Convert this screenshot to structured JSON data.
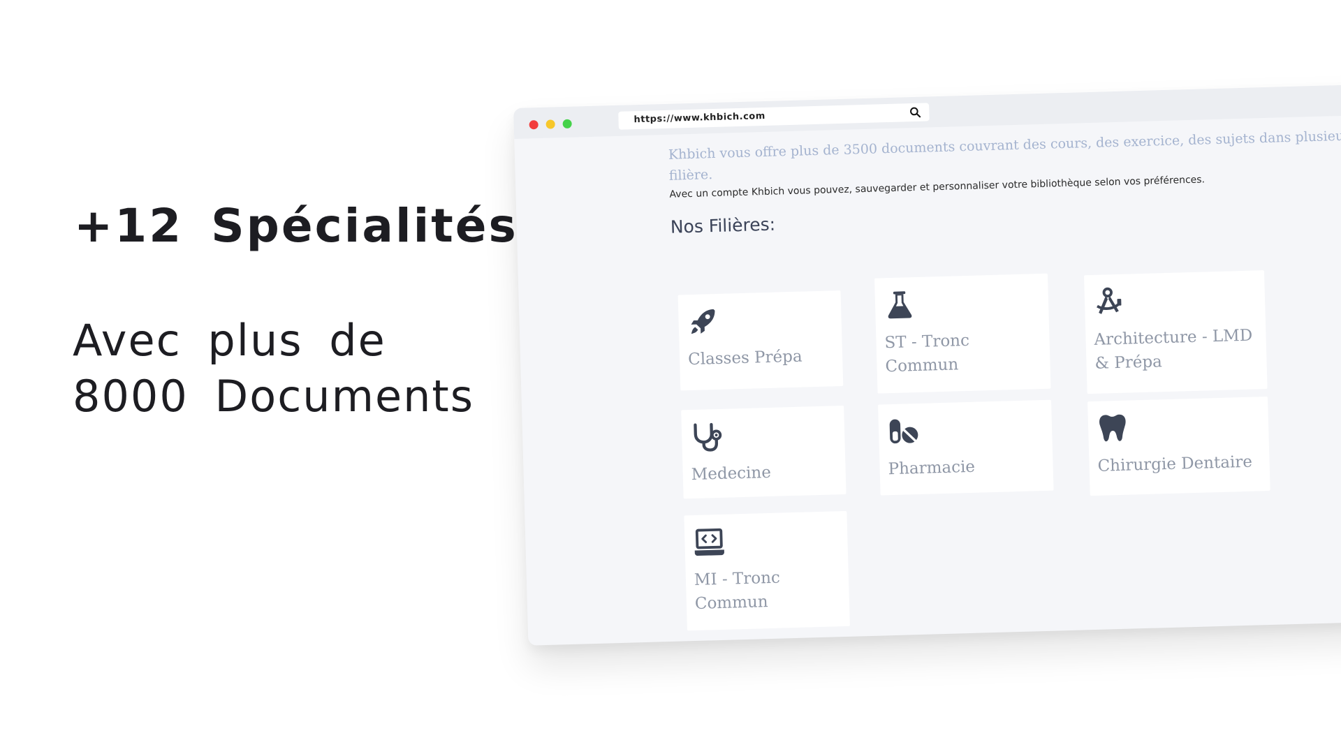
{
  "promo": {
    "headline": "+12 Spécialités",
    "sub_line1": "Avec plus de",
    "sub_line2_prefix": "8000",
    "sub_line2_highlight": "Documents",
    "highlight_color": "#ffe14a"
  },
  "browser": {
    "url": "https://www.khbich.com",
    "traffic_lights": [
      "#f23d3d",
      "#f7c72a",
      "#45d24a"
    ],
    "intro": "Khbich vous offre plus de 3500 documents couvrant des cours, des exercice, des sujets dans plusieurs filière.",
    "account_note": "Avec un compte Khbich vous pouvez, sauvegarder et personnaliser votre bibliothèque selon vos préférences.",
    "section_title": "Nos Filières:",
    "cards": [
      {
        "label": "Classes Prépa",
        "icon": "rocket-icon"
      },
      {
        "label": "ST - Tronc Commun",
        "icon": "flask-icon"
      },
      {
        "label": "Architecture - LMD & Prépa",
        "icon": "compass-drafting-icon"
      },
      {
        "label": "Medecine",
        "icon": "stethoscope-icon"
      },
      {
        "label": "Pharmacie",
        "icon": "pills-icon"
      },
      {
        "label": "Chirurgie Dentaire",
        "icon": "tooth-icon"
      },
      {
        "label": "MI - Tronc Commun",
        "icon": "laptop-code-icon"
      }
    ]
  }
}
